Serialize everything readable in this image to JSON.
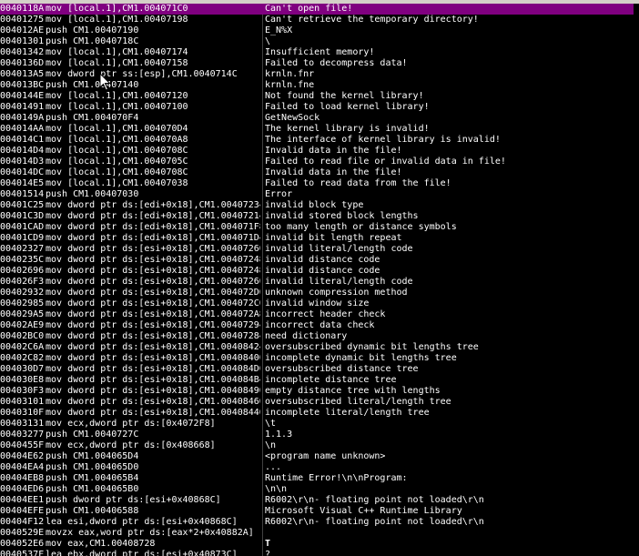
{
  "rows": [
    {
      "addr": "0040118A",
      "disasm": "mov [local.1],CM1.004071C0",
      "str": "Can't open file!",
      "selected": true
    },
    {
      "addr": "00401275",
      "disasm": "mov [local.1],CM1.00407198",
      "str": "Can't retrieve the temporary directory!"
    },
    {
      "addr": "004012AE",
      "disasm": "push CM1.00407190",
      "str": "E_N%X"
    },
    {
      "addr": "00401301",
      "disasm": "push CM1.0040718C",
      "str": "\\"
    },
    {
      "addr": "00401342",
      "disasm": "mov [local.1],CM1.00407174",
      "str": "Insufficient memory!"
    },
    {
      "addr": "0040136D",
      "disasm": "mov [local.1],CM1.00407158",
      "str": "Failed to decompress data!"
    },
    {
      "addr": "004013A5",
      "disasm": "mov dword ptr ss:[esp],CM1.0040714C",
      "str": "krnln.fnr"
    },
    {
      "addr": "004013BC",
      "disasm": "push CM1.00407140",
      "str": "krnln.fne"
    },
    {
      "addr": "0040144E",
      "disasm": "mov [local.1],CM1.00407120",
      "str": "Not found the kernel library!"
    },
    {
      "addr": "00401491",
      "disasm": "mov [local.1],CM1.00407100",
      "str": "Failed to load kernel library!"
    },
    {
      "addr": "0040149A",
      "disasm": "push CM1.004070F4",
      "str": "GetNewSock"
    },
    {
      "addr": "004014AA",
      "disasm": "mov [local.1],CM1.004070D4",
      "str": "The kernel library is invalid!"
    },
    {
      "addr": "004014C1",
      "disasm": "mov [local.1],CM1.004070A8",
      "str": "The interface of kernel library is invalid!"
    },
    {
      "addr": "004014D4",
      "disasm": "mov [local.1],CM1.0040708C",
      "str": "Invalid data in the file!"
    },
    {
      "addr": "004014D3",
      "disasm": "mov [local.1],CM1.0040705C",
      "str": "Failed to read file or invalid data in file!"
    },
    {
      "addr": "004014DC",
      "disasm": "mov [local.1],CM1.0040708C",
      "str": "Invalid data in the file!"
    },
    {
      "addr": "004014E5",
      "disasm": "mov [local.1],CM1.00407038",
      "str": "Failed to read data from the file!"
    },
    {
      "addr": "00401514",
      "disasm": "push CM1.00407030",
      "str": "Error"
    },
    {
      "addr": "00401C25",
      "disasm": "mov dword ptr ds:[edi+0x18],CM1.00407234",
      "str": "invalid block type"
    },
    {
      "addr": "00401C3D",
      "disasm": "mov dword ptr ds:[edi+0x18],CM1.00407214",
      "str": "invalid stored block lengths"
    },
    {
      "addr": "00401CAD",
      "disasm": "mov dword ptr ds:[edi+0x18],CM1.004071F8",
      "str": "too many length or distance symbols"
    },
    {
      "addr": "00401CD9",
      "disasm": "mov dword ptr ds:[edi+0x18],CM1.004071D4",
      "str": "invalid bit length repeat"
    },
    {
      "addr": "00402327",
      "disasm": "mov dword ptr ds:[esi+0x18],CM1.00407260",
      "str": "invalid literal/length code"
    },
    {
      "addr": "0040235C",
      "disasm": "mov dword ptr ds:[esi+0x18],CM1.00407248",
      "str": "invalid distance code"
    },
    {
      "addr": "00402696",
      "disasm": "mov dword ptr ds:[esi+0x18],CM1.00407248",
      "str": "invalid distance code"
    },
    {
      "addr": "004026F3",
      "disasm": "mov dword ptr ds:[esi+0x18],CM1.00407260",
      "str": "invalid literal/length code"
    },
    {
      "addr": "00402932",
      "disasm": "mov dword ptr ds:[esi+0x18],CM1.004072D0",
      "str": "unknown compression method"
    },
    {
      "addr": "00402985",
      "disasm": "mov dword ptr ds:[esi+0x18],CM1.004072C0",
      "str": "invalid window size"
    },
    {
      "addr": "004029A5",
      "disasm": "mov dword ptr ds:[esi+0x18],CM1.004072A8",
      "str": "incorrect header check"
    },
    {
      "addr": "00402AE9",
      "disasm": "mov dword ptr ds:[esi+0x18],CM1.00407294",
      "str": "incorrect data check"
    },
    {
      "addr": "00402BC0",
      "disasm": "mov dword ptr ds:[esi+0x18],CM1.00407284",
      "str": "need dictionary"
    },
    {
      "addr": "00402C6A",
      "disasm": "mov dword ptr ds:[esi+0x18],CM1.00408424",
      "str": "oversubscribed dynamic bit lengths tree"
    },
    {
      "addr": "00402C82",
      "disasm": "mov dword ptr ds:[esi+0x18],CM1.00408400",
      "str": "incomplete dynamic bit lengths tree"
    },
    {
      "addr": "004030D7",
      "disasm": "mov dword ptr ds:[esi+0x18],CM1.004084D0",
      "str": "oversubscribed distance tree"
    },
    {
      "addr": "004030E8",
      "disasm": "mov dword ptr ds:[esi+0x18],CM1.004084B4",
      "str": "incomplete distance tree"
    },
    {
      "addr": "004030F3",
      "disasm": "mov dword ptr ds:[esi+0x18],CM1.00408490",
      "str": "empty distance tree with lengths"
    },
    {
      "addr": "00403101",
      "disasm": "mov dword ptr ds:[esi+0x18],CM1.00408460",
      "str": "oversubscribed literal/length tree"
    },
    {
      "addr": "0040310F",
      "disasm": "mov dword ptr ds:[esi+0x18],CM1.00408440",
      "str": "incomplete literal/length tree"
    },
    {
      "addr": "00403131",
      "disasm": "mov ecx,dword ptr ds:[0x4072F8]",
      "str": "\\t"
    },
    {
      "addr": "00403277",
      "disasm": "push CM1.0040727C",
      "str": "1.1.3"
    },
    {
      "addr": "0040455F",
      "disasm": "mov ecx,dword ptr ds:[0x408668]",
      "str": "\\n"
    },
    {
      "addr": "00404E62",
      "disasm": "push CM1.004065D4",
      "str": "<program name unknown>"
    },
    {
      "addr": "00404EA4",
      "disasm": "push CM1.004065D0",
      "str": "..."
    },
    {
      "addr": "00404EB8",
      "disasm": "push CM1.004065B4",
      "str": "Runtime Error!\\n\\nProgram:"
    },
    {
      "addr": "00404ED6",
      "disasm": "push CM1.004065B0",
      "str": "\\n\\n"
    },
    {
      "addr": "00404EE1",
      "disasm": "push dword ptr ds:[esi+0x40868C]",
      "str": "R6002\\r\\n- floating point not loaded\\r\\n"
    },
    {
      "addr": "00404EFE",
      "disasm": "push CM1.00406588",
      "str": "Microsoft Visual C++ Runtime Library"
    },
    {
      "addr": "00404F12",
      "disasm": "lea esi,dword ptr ds:[esi+0x40868C]",
      "str": "R6002\\r\\n- floating point not loaded\\r\\n"
    },
    {
      "addr": "0040529E",
      "disasm": "movzx eax,word ptr ds:[eax*2+0x40882A]",
      "str": ""
    },
    {
      "addr": "004052E6",
      "disasm": "mov eax,CM1.00408728",
      "str": "T",
      "bold": true
    },
    {
      "addr": "0040537F",
      "disasm": "lea ebx,dword ptr ds:[esi+0x40873C]",
      "str": "?"
    }
  ]
}
